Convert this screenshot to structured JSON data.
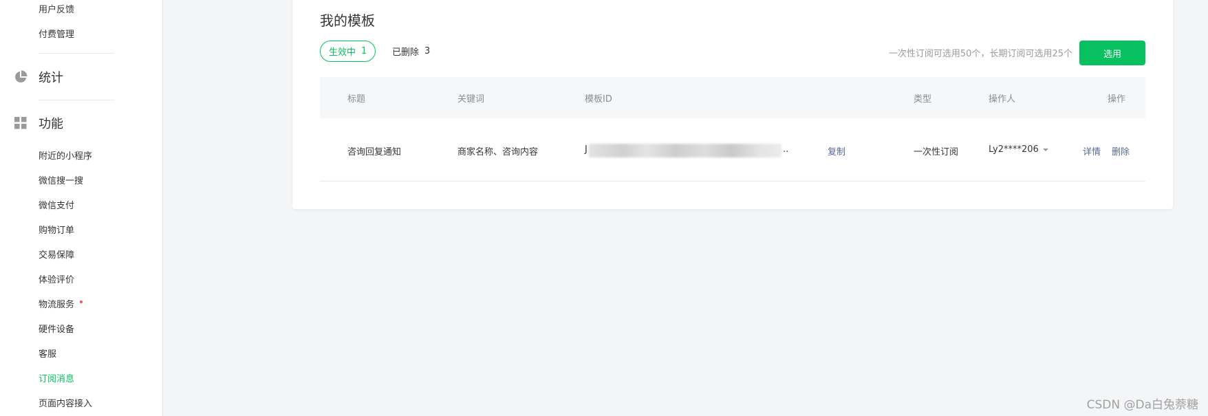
{
  "sidebar": {
    "items_top": [
      {
        "label": "用户反馈"
      },
      {
        "label": "付费管理"
      }
    ],
    "section_stats": {
      "label": "统计",
      "icon": "pie-chart-icon"
    },
    "section_features": {
      "label": "功能",
      "icon": "grid-icon"
    },
    "items": [
      {
        "label": "附近的小程序"
      },
      {
        "label": "微信搜一搜"
      },
      {
        "label": "微信支付"
      },
      {
        "label": "购物订单"
      },
      {
        "label": "交易保障"
      },
      {
        "label": "体验评价"
      },
      {
        "label": "物流服务"
      },
      {
        "label": "硬件设备"
      },
      {
        "label": "客服"
      },
      {
        "label": "订阅消息"
      },
      {
        "label": "页面内容接入"
      }
    ],
    "active_item": "订阅消息",
    "active_color": "#07c160",
    "badge_color": "#fa5151"
  },
  "main": {
    "title": "我的模板",
    "tabs": [
      {
        "label": "生效中",
        "count": "1",
        "active": true
      },
      {
        "label": "已删除",
        "count": "3",
        "active": false
      }
    ],
    "quota_hint": "一次性订阅可选用50个，长期订阅可选用25个",
    "select_button": "选用",
    "table": {
      "headers": [
        "标题",
        "关键词",
        "模板ID",
        "类型",
        "操作人",
        "操作"
      ],
      "rows": [
        {
          "title": "咨询回复通知",
          "keywords": "商家名称、咨询内容",
          "template_id_start": "J",
          "template_id_end": "..",
          "copy_label": "复制",
          "type": "一次性订阅",
          "operator": "Ly2****206",
          "action_detail": "详情",
          "action_delete": "删除"
        }
      ]
    }
  },
  "watermark": "CSDN @Da白兔萘糖",
  "colors": {
    "accent": "#07c160",
    "link": "#576b95",
    "background": "#f4f5f7"
  }
}
